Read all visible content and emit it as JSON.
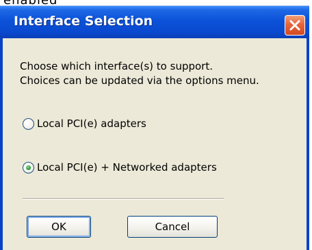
{
  "overflow_text": "enabled",
  "dialog": {
    "title": "Interface Selection",
    "close_icon": "close-icon",
    "message_line1": "Choose which interface(s) to support.",
    "message_line2": "Choices can be updated via the options menu.",
    "options": [
      {
        "label": "Local PCI(e) adapters",
        "selected": false
      },
      {
        "label": "Local PCI(e) + Networked adapters",
        "selected": true
      }
    ],
    "ok_label": "OK",
    "cancel_label": "Cancel"
  },
  "colors": {
    "titlebar": "#0a49cf",
    "client_bg": "#ece9d8",
    "close_button": "#e8643a",
    "selected_dot": "#2ea043"
  }
}
